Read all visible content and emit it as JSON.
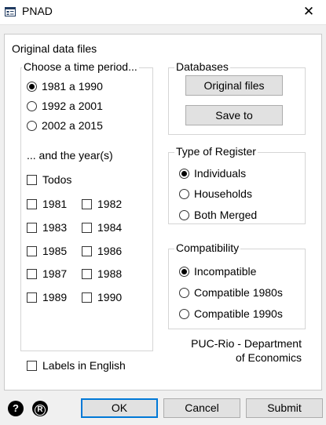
{
  "window": {
    "title": "PNAD",
    "icon": "form-window-icon",
    "close_icon": "close-icon",
    "close_glyph": "✕"
  },
  "section_title": "Original data files",
  "period_group": {
    "label": "Choose a time period...",
    "options": [
      {
        "label": "1981 a 1990",
        "selected": true
      },
      {
        "label": "1992 a 2001",
        "selected": false
      },
      {
        "label": "2002 a 2015",
        "selected": false
      }
    ],
    "years_label": "... and the year(s)",
    "all_label": "Todos",
    "years_col1": [
      "1981",
      "1983",
      "1985",
      "1987",
      "1989"
    ],
    "years_col2": [
      "1982",
      "1984",
      "1986",
      "1988",
      "1990"
    ]
  },
  "databases": {
    "label": "Databases",
    "original_files_button": "Original files",
    "save_to_button": "Save to"
  },
  "register": {
    "label": "Type of Register",
    "options": [
      {
        "label": "Individuals",
        "selected": true
      },
      {
        "label": "Households",
        "selected": false
      },
      {
        "label": "Both Merged",
        "selected": false
      }
    ]
  },
  "compatibility": {
    "label": "Compatibility",
    "options": [
      {
        "label": "Incompatible",
        "selected": true
      },
      {
        "label": "Compatible 1980s",
        "selected": false
      },
      {
        "label": "Compatible 1990s",
        "selected": false
      }
    ]
  },
  "credit": {
    "line1": "PUC-Rio - Department",
    "line2": "of Economics"
  },
  "labels_in_english": "Labels in English",
  "footer": {
    "help_icon": "help-icon",
    "help_glyph": "?",
    "r_icon": "registered-r-icon",
    "r_glyph": "R",
    "ok": "OK",
    "cancel": "Cancel",
    "submit": "Submit"
  }
}
